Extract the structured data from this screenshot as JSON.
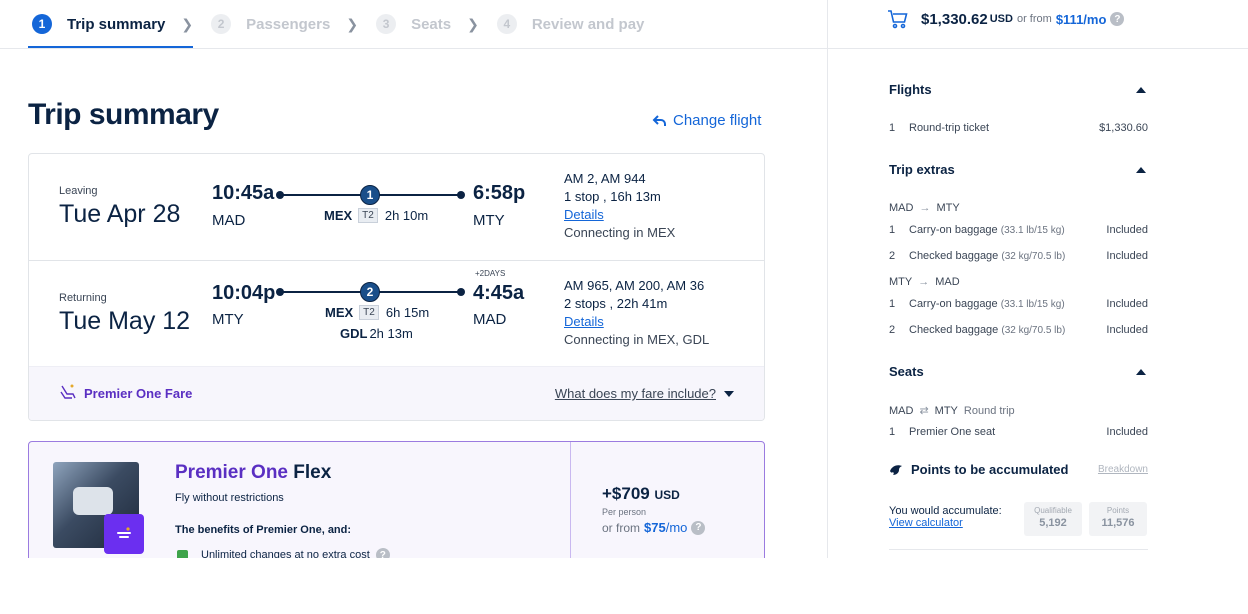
{
  "steps": [
    {
      "num": "1",
      "label": "Trip summary"
    },
    {
      "num": "2",
      "label": "Passengers"
    },
    {
      "num": "3",
      "label": "Seats"
    },
    {
      "num": "4",
      "label": "Review and pay"
    }
  ],
  "top_price": {
    "amount": "$1,330.62",
    "currency": "USD",
    "or_from": "or from",
    "monthly": "$111/mo",
    "help": "?"
  },
  "title": "Trip summary",
  "change_flight": "Change flight",
  "legs": [
    {
      "kind": "Leaving",
      "date": "Tue Apr 28",
      "dep_time": "10:45a",
      "dep_airport": "MAD",
      "arr_time": "6:58p",
      "arr_airport": "MTY",
      "plus_days": "",
      "stops_count": "1",
      "stops": [
        {
          "airport": "MEX",
          "terminal": "T2",
          "duration": "2h 10m"
        }
      ],
      "flights": "AM 2, AM 944",
      "summary": "1 stop , 16h 13m",
      "details": "Details",
      "connecting": "Connecting in MEX"
    },
    {
      "kind": "Returning",
      "date": "Tue May 12",
      "dep_time": "10:04p",
      "dep_airport": "MTY",
      "arr_time": "4:45a",
      "arr_airport": "MAD",
      "plus_days": "+2DAYS",
      "stops_count": "2",
      "stops": [
        {
          "airport": "MEX",
          "terminal": "T2",
          "duration": "6h 15m"
        },
        {
          "airport": "GDL",
          "terminal": "",
          "duration": "2h 13m"
        }
      ],
      "flights": "AM 965, AM 200, AM 36",
      "summary": "2 stops , 22h 41m",
      "details": "Details",
      "connecting": "Connecting in MEX, GDL"
    }
  ],
  "fare": {
    "name": "Premier One Fare",
    "include_link": "What does my fare include?"
  },
  "upsell": {
    "title_part1": "Premier One",
    "title_part2": "Flex",
    "subtitle": "Fly without restrictions",
    "benefits_title": "The benefits of Premier One, and:",
    "benefit1": "Unlimited changes at no extra cost",
    "price": "+$709",
    "currency": "USD",
    "per_person": "Per person",
    "or_from": "or from",
    "monthly_amount": "$75",
    "monthly_suffix": "/mo"
  },
  "summary": {
    "flights": {
      "title": "Flights",
      "rows": [
        {
          "n": "1",
          "desc": "Round-trip ticket",
          "value": "$1,330.60"
        }
      ]
    },
    "extras": {
      "title": "Trip extras",
      "groups": [
        {
          "from": "MAD",
          "to": "MTY",
          "rows": [
            {
              "n": "1",
              "desc": "Carry-on baggage",
              "detail": "(33.1 lb/15 kg)",
              "value": "Included"
            },
            {
              "n": "2",
              "desc": "Checked baggage",
              "detail": "(32 kg/70.5 lb)",
              "value": "Included"
            }
          ]
        },
        {
          "from": "MTY",
          "to": "MAD",
          "rows": [
            {
              "n": "1",
              "desc": "Carry-on baggage",
              "detail": "(33.1 lb/15 kg)",
              "value": "Included"
            },
            {
              "n": "2",
              "desc": "Checked baggage",
              "detail": "(32 kg/70.5 lb)",
              "value": "Included"
            }
          ]
        }
      ]
    },
    "seats": {
      "title": "Seats",
      "from": "MAD",
      "to": "MTY",
      "trip": "Round trip",
      "rows": [
        {
          "n": "1",
          "desc": "Premier One seat",
          "value": "Included"
        }
      ]
    },
    "points": {
      "title": "Points to be accumulated",
      "breakdown": "Breakdown",
      "accumulate": "You would accumulate:",
      "calculator": "View calculator",
      "qualifiable_label": "Qualifiable",
      "qualifiable_value": "5,192",
      "points_label": "Points",
      "points_value": "11,576"
    }
  },
  "colors": {
    "accent": "#1466d8",
    "navy": "#0b2343",
    "purple": "#5a2fc2"
  }
}
